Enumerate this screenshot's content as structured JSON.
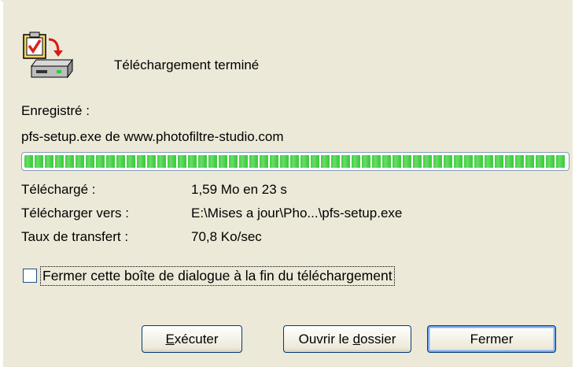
{
  "dialog": {
    "title": "Téléchargement terminé",
    "saved_label": "Enregistré :",
    "saved_file": "pfs-setup.exe de www.photofiltre-studio.com",
    "progress": 1.0,
    "details": [
      {
        "label": "Téléchargé :",
        "value": "1,59 Mo en 23 s"
      },
      {
        "label": "Télécharger vers :",
        "value": "E:\\Mises a jour\\Pho...\\pfs-setup.exe"
      },
      {
        "label": "Taux de transfert :",
        "value": "70,8 Ko/sec"
      }
    ],
    "close_when_done": {
      "label": "Fermer cette boîte de dialogue à la fin du téléchargement",
      "checked": false
    },
    "buttons": {
      "run_prefix": "E",
      "run_accel": "x",
      "run_rest": "écuter",
      "open_prefix": "Ouvrir le ",
      "open_accel": "d",
      "open_rest": "ossier",
      "close": "Fermer"
    }
  },
  "colors": {
    "background": "#ece9d8",
    "progress_green": "#3fce3f",
    "button_border": "#003c74"
  }
}
